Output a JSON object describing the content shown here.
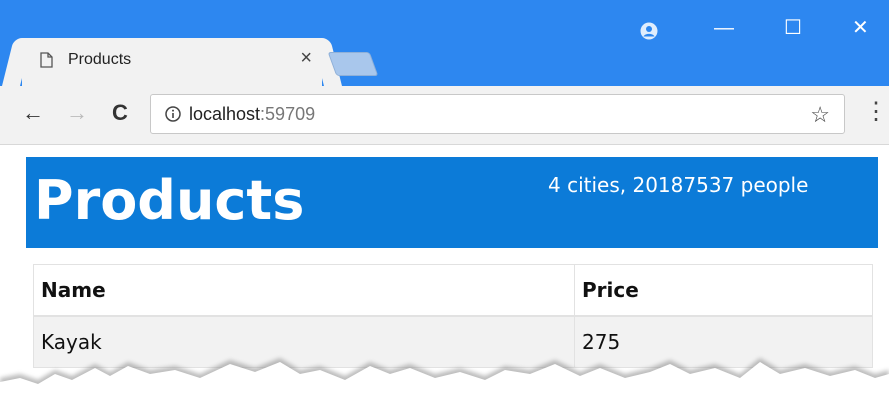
{
  "browser": {
    "tab_title": "Products",
    "tab_close": "×",
    "url_host": "localhost",
    "url_port": ":59709",
    "back": "←",
    "forward": "→",
    "reload": "C",
    "star": "☆",
    "menu": "⋮",
    "minimize": "—",
    "maximize": "☐",
    "close": "✕",
    "accent_color": "#2d87f0"
  },
  "page": {
    "heading": "Products",
    "stats": "4 cities, 20187537 people",
    "header_color": "#0c7bd8",
    "table": {
      "headers": [
        "Name",
        "Price"
      ],
      "rows": [
        [
          "Kayak",
          "275"
        ]
      ]
    }
  }
}
